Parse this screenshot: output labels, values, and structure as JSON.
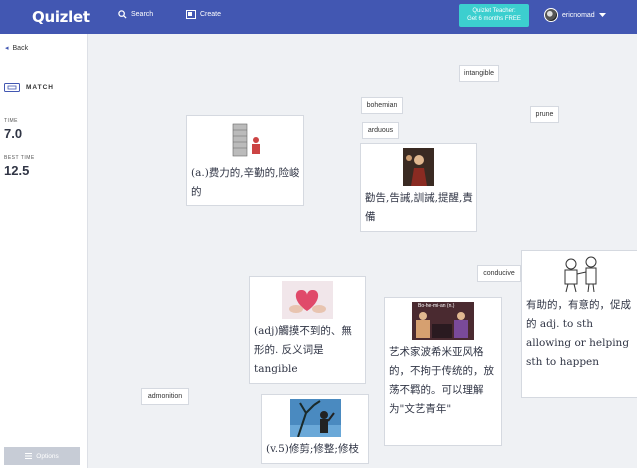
{
  "header": {
    "logo": "Quizlet",
    "search_label": "Search",
    "create_label": "Create",
    "promo_line1": "Quizlet Teacher:",
    "promo_line2": "Get 6 months FREE",
    "username": "ericnomad"
  },
  "sidebar": {
    "back_label": "Back",
    "mode_label": "MATCH",
    "time_label": "TIME",
    "time_value": "7.0",
    "best_label": "BEST TIME",
    "best_value": "12.5",
    "options_label": "Options"
  },
  "words": {
    "intangible": "intangible",
    "bohemian": "bohemian",
    "prune": "prune",
    "arduous": "arduous",
    "conducive": "conducive",
    "admonition": "admonition"
  },
  "cards": {
    "arduous_def": "(a.)费力的,辛勤的,险峻的",
    "admonition_def": "勸告,告誡,訓誡,提醒,責備",
    "intangible_def": "(adj)觸摸不到的、無形的. 反义词是tangible",
    "bohemian_def": "艺术家波希米亚风格的，不拘于传统的，放荡不羁的。可以理解为\"文艺青年\"",
    "conducive_def": "有助的，有意的，促成的 adj. to sth allowing or helping sth to happen",
    "prune_def": "(v.5)修剪;修整;修枝",
    "bohemian_image_caption": "Bo-he-mi-an (n.)"
  },
  "colors": {
    "header": "#4257b2",
    "promo": "#3ccfcf",
    "canvas": "#eff1f4"
  }
}
